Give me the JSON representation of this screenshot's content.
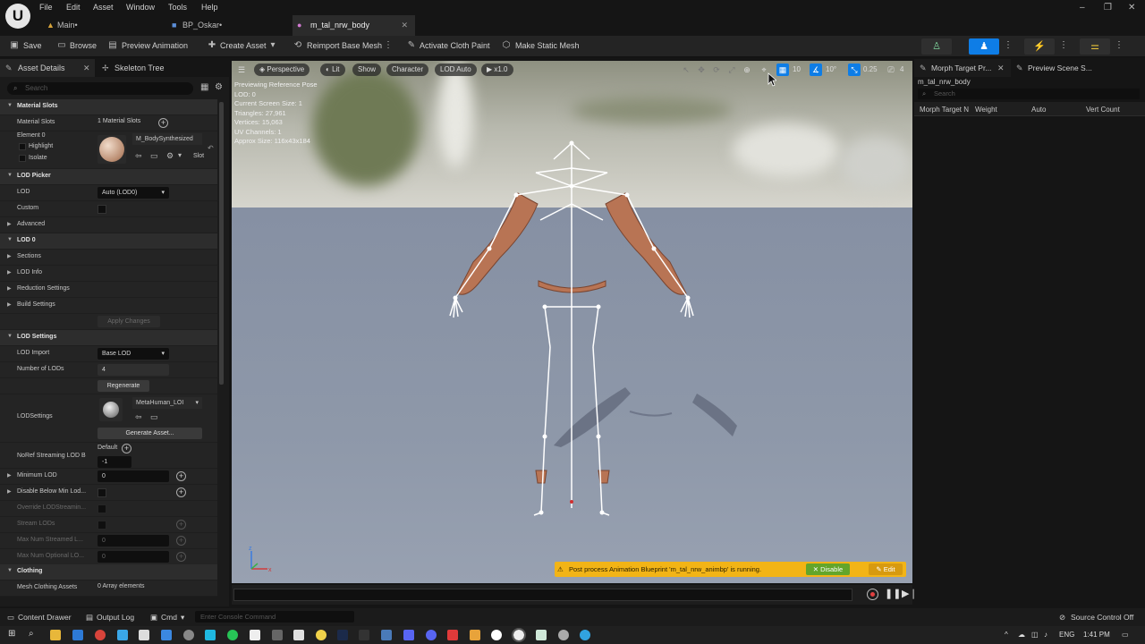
{
  "menu": {
    "items": [
      "File",
      "Edit",
      "Asset",
      "Window",
      "Tools",
      "Help"
    ]
  },
  "tabs": [
    {
      "label": "Main•"
    },
    {
      "label": "BP_Oskar•"
    },
    {
      "label": "m_tal_nrw_body"
    }
  ],
  "toolbar": {
    "save": "Save",
    "browse": "Browse",
    "preview_animation": "Preview Animation",
    "create_asset": "Create Asset",
    "reimport": "Reimport Base Mesh",
    "cloth_paint": "Activate Cloth Paint",
    "static_mesh": "Make Static Mesh"
  },
  "left_panel": {
    "tab_details": "Asset Details",
    "tab_skeleton": "Skeleton Tree",
    "search_placeholder": "Search",
    "rows": {
      "material_slots_cat": "Material Slots",
      "material_slots": "Material Slots",
      "material_slots_value": "1 Material Slots",
      "element0": "Element 0",
      "highlight": "Highlight",
      "isolate": "Isolate",
      "material_name": "M_BodySynthesized",
      "slot": "Slot",
      "lod_picker": "LOD Picker",
      "lod": "LOD",
      "lod_value": "Auto (LOD0)",
      "custom": "Custom",
      "advanced": "Advanced",
      "lod0": "LOD 0",
      "sections": "Sections",
      "lod_info": "LOD Info",
      "reduction": "Reduction Settings",
      "build": "Build Settings",
      "apply": "Apply Changes",
      "lod_settings": "LOD Settings",
      "lod_import": "LOD Import",
      "lod_import_value": "Base LOD",
      "num_lods": "Number of LODs",
      "num_lods_value": "4",
      "regenerate": "Regenerate",
      "lodsettings": "LODSettings",
      "lodsettings_asset": "MetaHuman_LOI",
      "generate": "Generate Asset...",
      "noref": "NoRef Streaming LOD B",
      "default": "Default",
      "noref_value": "-1",
      "min_lod": "Minimum LOD",
      "min_lod_value": "0",
      "disable_below": "Disable Below Min Lod...",
      "override": "Override LODStreamin...",
      "stream": "Stream LODs",
      "max_streamed": "Max Num Streamed L...",
      "max_streamed_value": "0",
      "max_optional": "Max Num Optional LO...",
      "max_optional_value": "0",
      "clothing": "Clothing",
      "mesh_clothing": "Mesh Clothing Assets",
      "mesh_clothing_value": "0 Array elements"
    }
  },
  "viewport": {
    "perspective": "Perspective",
    "lit": "Lit",
    "show": "Show",
    "character": "Character",
    "lod_auto": "LOD Auto",
    "speed": "x1.0",
    "grid": "10",
    "angle": "10°",
    "scale": "0.25",
    "camera": "4",
    "info": [
      "Previewing Reference Pose",
      "LOD: 0",
      "Current Screen Size: 1",
      "Triangles: 27,961",
      "Vertices: 15,063",
      "UV Channels: 1",
      "Approx Size: 116x43x184"
    ],
    "notice": "Post process Animation Blueprint 'm_tal_nrw_animbp' is running.",
    "disable": "Disable",
    "edit": "Edit"
  },
  "right_panel": {
    "tab_morph": "Morph Target Pr...",
    "tab_scene": "Preview Scene S...",
    "asset_name": "m_tal_nrw_body",
    "search_placeholder": "Search",
    "columns": [
      "Morph Target N",
      "Weight",
      "Auto",
      "Vert Count"
    ]
  },
  "statusbar": {
    "content_drawer": "Content Drawer",
    "output_log": "Output Log",
    "cmd": "Cmd",
    "console_placeholder": "Enter Console Command",
    "source_control": "Source Control Off"
  },
  "taskbar": {
    "lang": "ENG",
    "time": "1:41 PM"
  }
}
